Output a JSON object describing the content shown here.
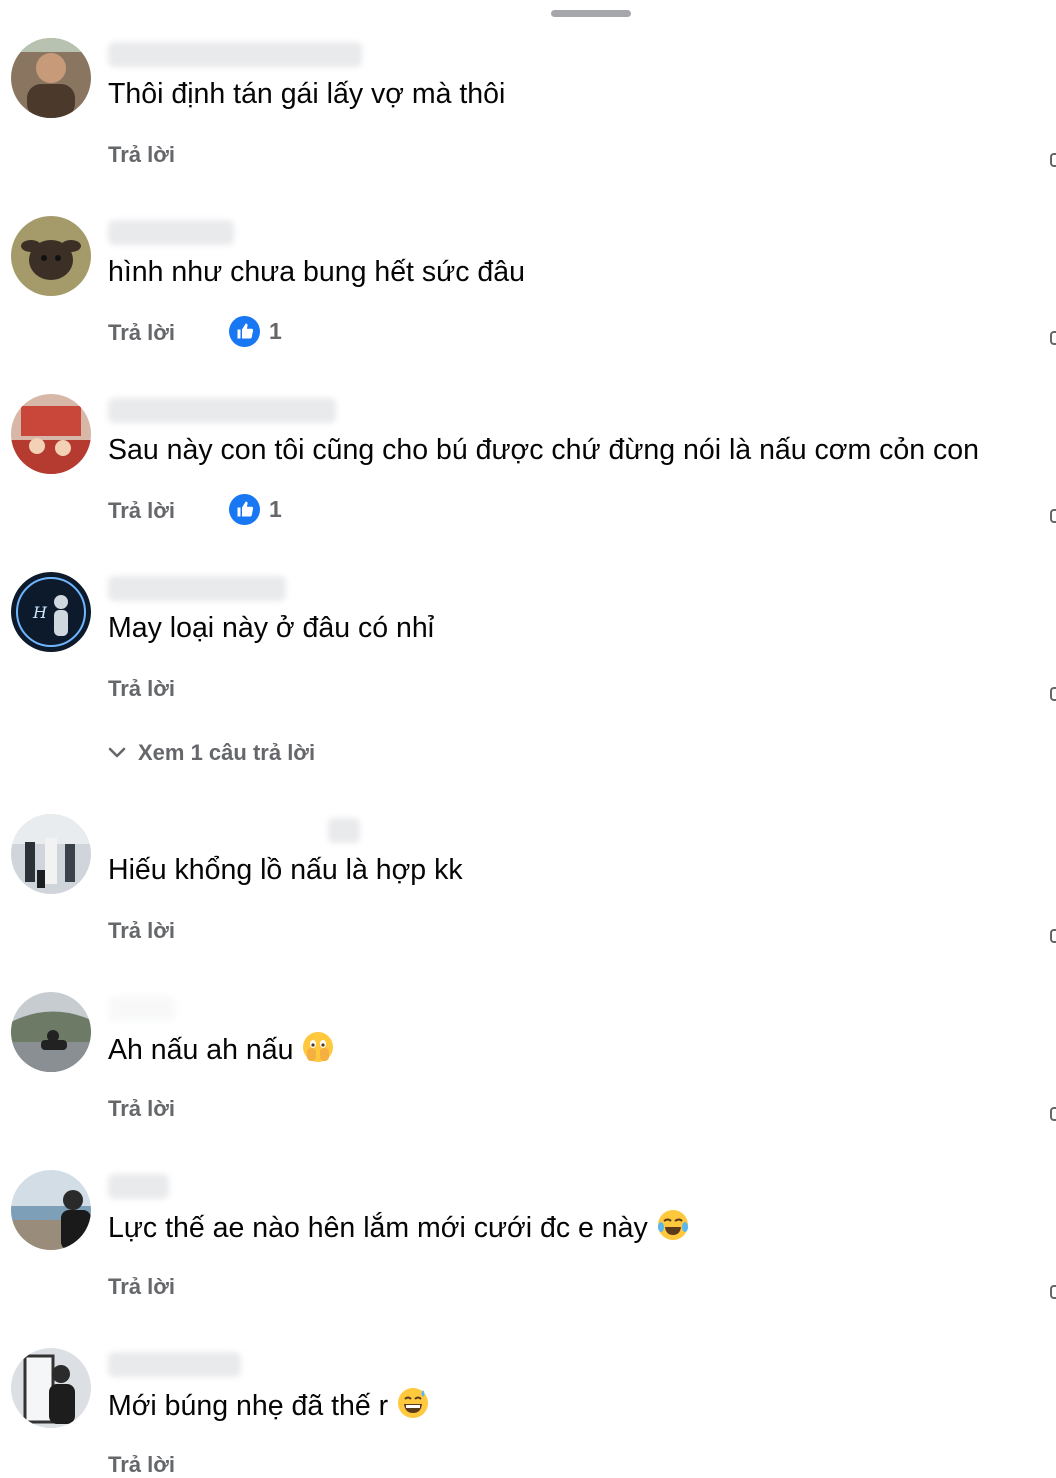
{
  "comments": [
    {
      "text": "Thôi định tán gái lấy vợ mà thôi",
      "reply": "Trả lời"
    },
    {
      "text": "hình như chưa bung hết sức  đâu",
      "reply": "Trả lời",
      "likes": "1"
    },
    {
      "text": "Sau này con tôi cũng cho bú được chứ đừng nói là nấu cơm cỏn con",
      "reply": "Trả lời",
      "likes": "1"
    },
    {
      "text": "May loại này ở đâu có nhỉ",
      "reply": "Trả lời",
      "view_replies": "Xem 1 câu trả lời"
    },
    {
      "text": "Hiếu khổng lồ nấu là hợp kk",
      "reply": "Trả lời"
    },
    {
      "text": "Ah nấu ah nấu",
      "reply": "Trả lời",
      "emoji": "face-with-hand-over-mouth-emoji"
    },
    {
      "text": "Lực thế ae nào hên lắm mới cưới đc e này",
      "reply": "Trả lời",
      "emoji": "tears-of-joy-emoji"
    },
    {
      "text": "Mới búng nhẹ đã thế r",
      "reply": "Trả lời",
      "emoji": "grinning-sweat-emoji"
    }
  ],
  "colors": {
    "like_blue": "#1877f2",
    "secondary_text": "#65676b"
  }
}
